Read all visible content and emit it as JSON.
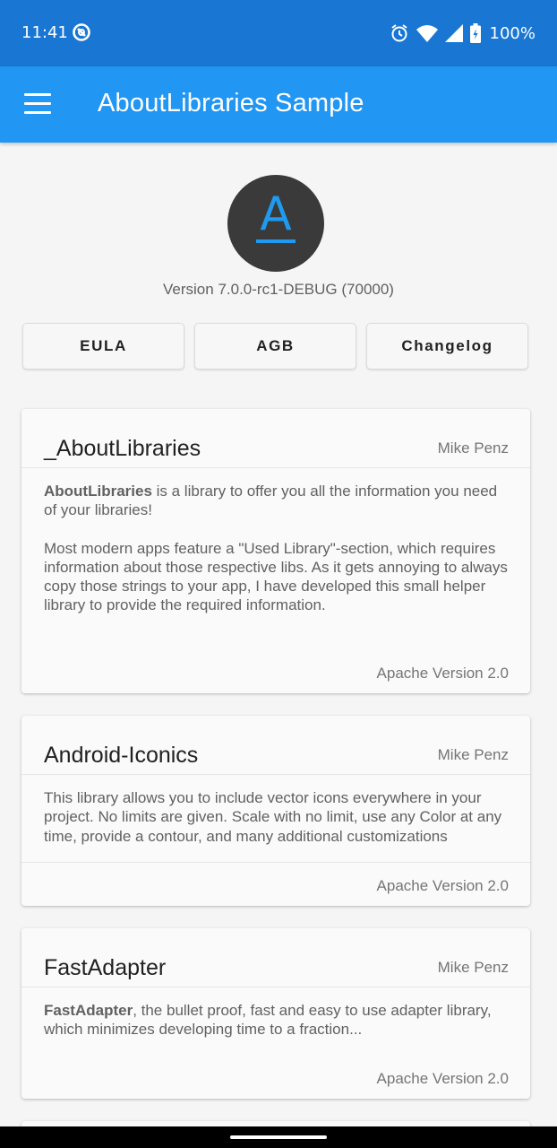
{
  "status_bar": {
    "time": "11:41",
    "battery": "100%"
  },
  "toolbar": {
    "title": "AboutLibraries Sample"
  },
  "header": {
    "logo_letter": "A",
    "version": "Version 7.0.0-rc1-DEBUG (70000)",
    "buttons": [
      "EULA",
      "AGB",
      "Changelog"
    ]
  },
  "libraries": [
    {
      "name": "_AboutLibraries",
      "author": "Mike Penz",
      "desc_bold": "AboutLibraries",
      "desc_text": " is a library to offer you all the information you need of your libraries!",
      "desc_para2": "Most modern apps feature a \"Used Library\"-section, which requires information about those respective libs. As it gets annoying to always copy those strings to your app, I have developed this small helper library to provide the required information.",
      "license": "Apache Version 2.0"
    },
    {
      "name": "Android-Iconics",
      "author": "Mike Penz",
      "desc_text": "This library allows you to include vector icons everywhere in your project. No limits are given. Scale with no limit, use any Color at any time, provide a contour, and many additional customizations",
      "license": "Apache Version 2.0"
    },
    {
      "name": "FastAdapter",
      "author": "Mike Penz",
      "desc_bold": "FastAdapter",
      "desc_text": ", the bullet proof, fast and easy to use adapter library, which minimizes developing time to a fraction...",
      "license": "Apache Version 2.0"
    }
  ],
  "colors": {
    "status_bar": "#1976d2",
    "toolbar": "#2196f3",
    "logo_accent": "#1e9bf0",
    "background": "#f5f5f5"
  }
}
